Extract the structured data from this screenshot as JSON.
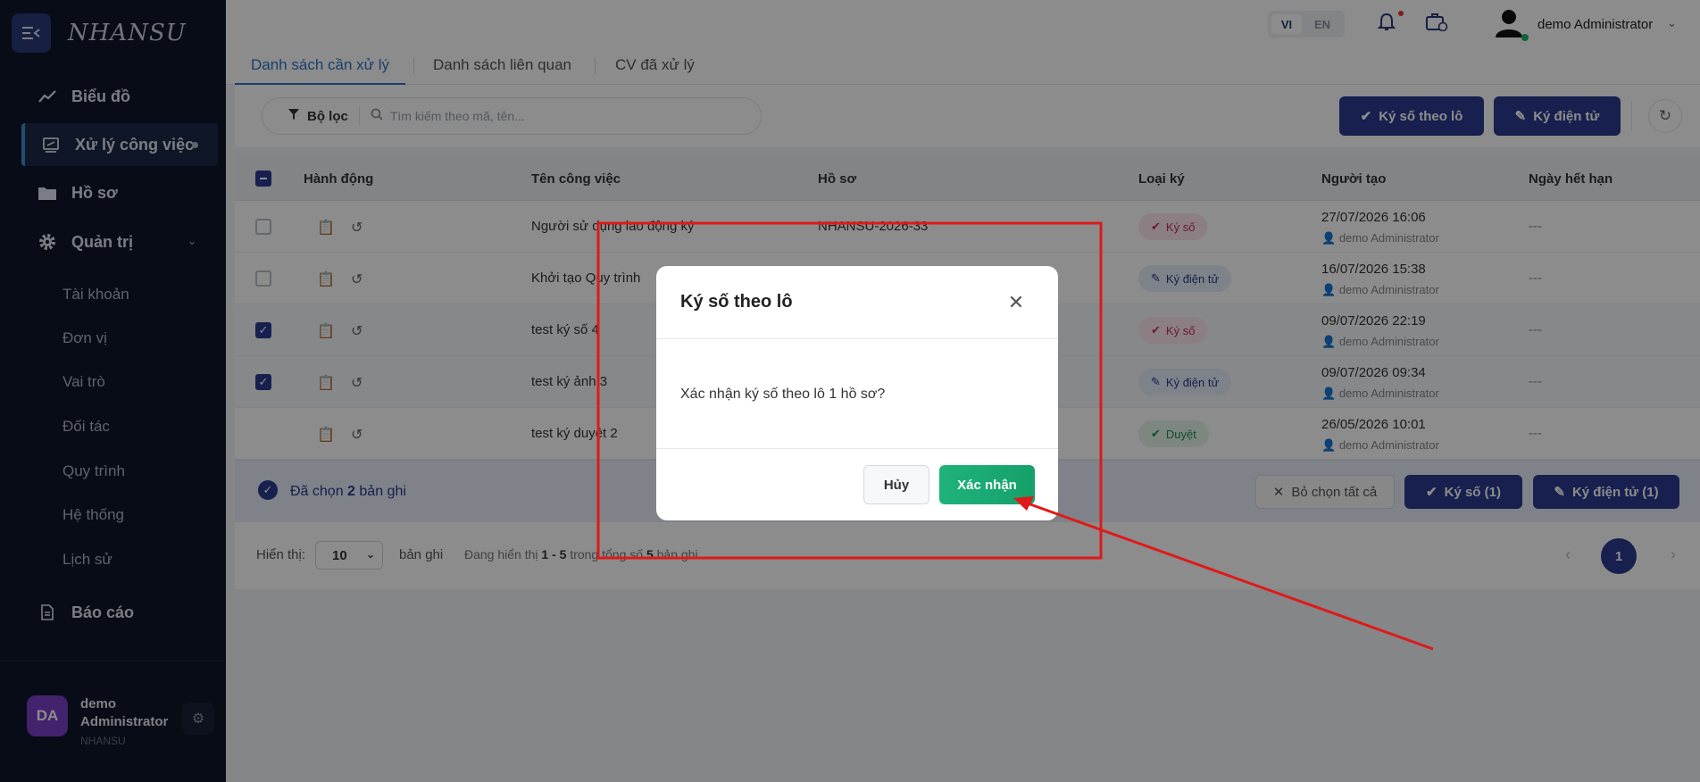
{
  "app": {
    "brand": "NHANSU"
  },
  "sidebar": {
    "items": [
      {
        "label": "Biểu đồ",
        "icon": "chart-line-icon"
      },
      {
        "label": "Xử lý công việc",
        "icon": "task-icon"
      },
      {
        "label": "Hồ sơ",
        "icon": "folder-icon"
      },
      {
        "label": "Quản trị",
        "icon": "gear-icon"
      }
    ],
    "subitems": [
      "Tài khoản",
      "Đơn vị",
      "Vai trò",
      "Đối tác",
      "Quy trình",
      "Hệ thống",
      "Lịch sử"
    ],
    "report": "Báo cáo",
    "user": {
      "initials": "DA",
      "name": "demo Administrator",
      "org": "NHANSU"
    }
  },
  "topbar": {
    "lang_vi": "VI",
    "lang_en": "EN",
    "user_name": "demo Administrator"
  },
  "tabs": [
    "Danh sách cần xử lý",
    "Danh sách liên quan",
    "CV đã xử lý"
  ],
  "toolbar": {
    "filter_label": "Bộ lọc",
    "search_placeholder": "Tìm kiếm theo mã, tên...",
    "batch_sign": "Ký số theo lô",
    "e_sign": "Ký điện tử"
  },
  "table": {
    "headers": [
      "Hành động",
      "Tên công việc",
      "Hồ sơ",
      "Loại ký",
      "Người tạo",
      "Ngày hết hạn"
    ],
    "rows": [
      {
        "name": "Người sử dụng lao động ký",
        "record": "NHANSU-2026-33",
        "type": "Ký số",
        "date": "27/07/2026 16:06",
        "user": "demo Administrator",
        "expire": "---",
        "checked": false
      },
      {
        "name": "Khởi tạo Quy trình",
        "record": "",
        "type": "Ký điện tử",
        "date": "16/07/2026 15:38",
        "user": "demo Administrator",
        "expire": "---",
        "checked": false
      },
      {
        "name": "test ký số 4",
        "record": "",
        "type": "Ký số",
        "date": "09/07/2026 22:19",
        "user": "demo Administrator",
        "expire": "---",
        "checked": true
      },
      {
        "name": "test ký ảnh 3",
        "record": "",
        "type": "Ký điện tử",
        "date": "09/07/2026 09:34",
        "user": "demo Administrator",
        "expire": "---",
        "checked": true
      },
      {
        "name": "test ký duyệt 2",
        "record": "",
        "type": "Duyệt",
        "date": "26/05/2026 10:01",
        "user": "demo Administrator",
        "expire": "---",
        "checked": null
      }
    ]
  },
  "selection": {
    "prefix": "Đã chọn",
    "count": "2",
    "suffix": "bản ghi",
    "clear_all": "Bỏ chọn tất cả",
    "sign_btn": "Ký số (1)",
    "esign_btn": "Ký điện tử (1)"
  },
  "pagination": {
    "show_label": "Hiển thị:",
    "page_size": "10",
    "unit": "bản ghi",
    "range_prefix": "Đang hiển thị",
    "range": "1 - 5",
    "range_mid": "trong tổng số",
    "total": "5",
    "range_suffix": "bản ghi",
    "current_page": "1"
  },
  "modal": {
    "title": "Ký số theo lô",
    "message": "Xác nhận ký số theo lô 1 hồ sơ?",
    "cancel": "Hủy",
    "confirm": "Xác nhận"
  },
  "colors": {
    "sidebar_bg": "#0f1629",
    "primary": "#2a3b8f",
    "confirm": "#1eb37b",
    "annotation": "#e01919"
  }
}
